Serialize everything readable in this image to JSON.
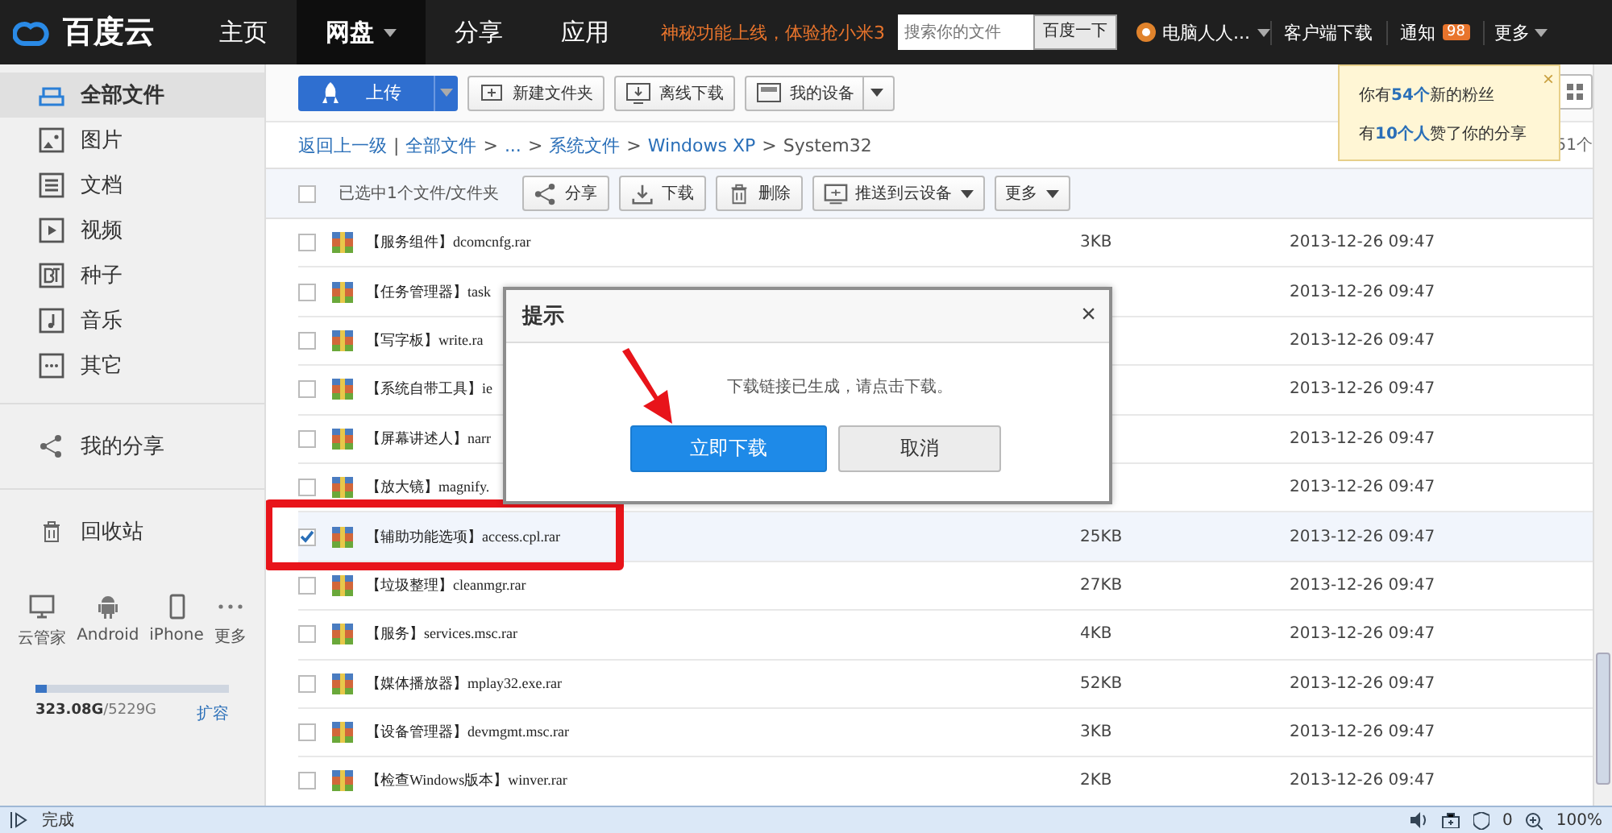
{
  "header": {
    "logo": "百度云",
    "nav": [
      {
        "label": "主页",
        "selected": false,
        "caret": false
      },
      {
        "label": "网盘",
        "selected": true,
        "caret": true
      },
      {
        "label": "分享",
        "selected": false,
        "caret": false
      },
      {
        "label": "应用",
        "selected": false,
        "caret": false
      }
    ],
    "promo": "神秘功能上线，体验抢小米3",
    "search": {
      "placeholder": "搜索你的文件",
      "button": "百度一下"
    },
    "user": "电脑人人...",
    "client_download": "客户端下载",
    "notice": {
      "label": "通知",
      "badge": "98"
    },
    "more": "更多"
  },
  "sidebar": {
    "items": [
      {
        "label": "全部文件",
        "selected": true
      },
      {
        "label": "图片",
        "selected": false
      },
      {
        "label": "文档",
        "selected": false
      },
      {
        "label": "视频",
        "selected": false
      },
      {
        "label": "种子",
        "selected": false
      },
      {
        "label": "音乐",
        "selected": false
      },
      {
        "label": "其它",
        "selected": false
      }
    ],
    "share": "我的分享",
    "recycle": "回收站",
    "devices": [
      "云管家",
      "Android",
      "iPhone",
      "更多"
    ],
    "storage": {
      "level": 0.062,
      "text": "**323.08G**/5229G",
      "expand": "扩容"
    }
  },
  "toolbar": {
    "upload": "上传",
    "buttons": [
      {
        "label": "新建文件夹",
        "caret": false
      },
      {
        "label": "离线下载",
        "caret": false
      },
      {
        "label": "我的设备",
        "caret": true
      }
    ]
  },
  "notification": {
    "close": "×",
    "lines": [
      "你有**54个**新的粉丝",
      "有**10个人**赞了你的分享"
    ]
  },
  "breadcrumb": {
    "back": "返回上一级",
    "back_separator": "|",
    "path": [
      {
        "label": "全部文件"
      },
      {
        "sep": ">",
        "label": "..."
      },
      {
        "sep": ">",
        "label": "系统文件"
      },
      {
        "sep": ">",
        "label": "Windows XP"
      },
      {
        "sep": ">",
        "label": "System32"
      }
    ],
    "count": "51个"
  },
  "actions": {
    "select_all_checked": false,
    "selected_text": "已选中1个文件/文件夹",
    "buttons": [
      {
        "label": "分享",
        "caret": false
      },
      {
        "label": "下载",
        "caret": false
      },
      {
        "label": "删除",
        "caret": false
      },
      {
        "label": "推送到云设备",
        "caret": true
      },
      {
        "label": "更多",
        "caret": true
      }
    ]
  },
  "files": [
    {
      "name": "【服务组件】dcomcnfg.rar",
      "size": "3KB",
      "date": "2013-12-26 09:47",
      "checked": false
    },
    {
      "name": "【任务管理器】task",
      "date": "2013-12-26 09:47",
      "checked": false
    },
    {
      "name": "【写字板】write.ra",
      "date": "2013-12-26 09:47",
      "checked": false
    },
    {
      "name": "【系统自带工具】ie",
      "date": "2013-12-26 09:47",
      "checked": false
    },
    {
      "name": "【屏幕讲述人】narr",
      "date": "2013-12-26 09:47",
      "checked": false
    },
    {
      "name": "【放大镜】magnify.",
      "date": "2013-12-26 09:47",
      "checked": false
    },
    {
      "name": "【辅助功能选项】access.cpl.rar",
      "size": "25KB",
      "date": "2013-12-26 09:47",
      "checked": true,
      "highlighted": true
    },
    {
      "name": "【垃圾整理】cleanmgr.rar",
      "size": "27KB",
      "date": "2013-12-26 09:47",
      "checked": false
    },
    {
      "name": "【服务】services.msc.rar",
      "size": "4KB",
      "date": "2013-12-26 09:47",
      "checked": false
    },
    {
      "name": "【媒体播放器】mplay32.exe.rar",
      "size": "52KB",
      "date": "2013-12-26 09:47",
      "checked": false
    },
    {
      "name": "【设备管理器】devmgmt.msc.rar",
      "size": "3KB",
      "date": "2013-12-26 09:47",
      "checked": false
    },
    {
      "name": "【检查Windows版本】winver.rar",
      "size": "2KB",
      "date": "2013-12-26 09:47",
      "checked": false
    }
  ],
  "dialog": {
    "title": "提示",
    "close": "×",
    "message": "下载链接已生成，请点击下载。",
    "buttons": [
      {
        "label": "立即下载",
        "primary": true
      },
      {
        "label": "取消",
        "primary": false
      }
    ]
  },
  "status_bar": {
    "text": "完成",
    "shield_count": "0",
    "zoom": "100%"
  }
}
